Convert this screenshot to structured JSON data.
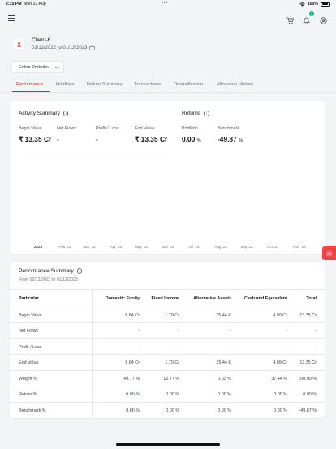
{
  "status": {
    "time": "2:15 PM",
    "date": "Mon 12 Aug",
    "battery": "100%"
  },
  "header": {
    "notification_count": "1"
  },
  "client": {
    "name": "Client-6",
    "date_range": "02/12/2022 to 01/12/2023"
  },
  "portfolio_select": {
    "value": "Entire Portfolio"
  },
  "tabs": [
    {
      "label": "Performance",
      "active": true
    },
    {
      "label": "Holdings"
    },
    {
      "label": "Return Summary"
    },
    {
      "label": "Transactions"
    },
    {
      "label": "Diversification"
    },
    {
      "label": "Allocation History"
    }
  ],
  "activity": {
    "title": "Activity Summary",
    "begin_label": "Begin Value",
    "begin_value": "₹ 13.35 Cr",
    "netflows_label": "Net Flows",
    "netflows_value": "-",
    "pl_label": "Profit / Loss",
    "pl_value": "-",
    "end_label": "End Value",
    "end_value": "₹ 13.35 Cr"
  },
  "returns": {
    "title": "Returns",
    "portfolio_label": "Portfolio",
    "portfolio_value": "0.00",
    "portfolio_unit": "%",
    "benchmark_label": "Benchmark",
    "benchmark_value": "-49.87",
    "benchmark_unit": "%"
  },
  "chart": {
    "x_ticks": [
      "2023",
      "Feb '23",
      "Mar '23",
      "Apr '23",
      "May '23",
      "Jun '23",
      "Jul '23",
      "Aug '23",
      "Sep '23",
      "Oct '23",
      "Nov '23"
    ]
  },
  "perf_summary": {
    "title": "Performance Summary",
    "subtitle": "From 02/12/2022 to 01/12/2023",
    "columns": [
      "Particular",
      "Domestic Equity",
      "Fixed Income",
      "Alternative Assets",
      "Cash and Equivalent",
      "Total"
    ],
    "rows": [
      [
        "Begin Value",
        "6.64 Cr",
        "1.70 Cr",
        "35.44 K",
        "4.99 Cr",
        "13.35 Cr"
      ],
      [
        "Net Flows",
        "-",
        "-",
        "-",
        "-",
        "-"
      ],
      [
        "Profit / Loss",
        "-",
        "-",
        "-",
        "-",
        "-"
      ],
      [
        "End Value",
        "6.64 Cr",
        "1.70 Cr",
        "35.44 K",
        "4.99 Cr",
        "13.35 Cr"
      ],
      [
        "Weight %",
        "49.77 %",
        "12.77 %",
        "0.03 %",
        "37.44 %",
        "100.00 %"
      ],
      [
        "Return %",
        "0.00 %",
        "0.00 %",
        "0.00 %",
        "0.00 %",
        "0.00 %"
      ],
      [
        "Benchmark %",
        "0.00 %",
        "0.00 %",
        "0.00 %",
        "0.00 %",
        "-49.87 %"
      ]
    ]
  },
  "colors": {
    "accent": "#dc2626",
    "badge": "#10b981"
  }
}
